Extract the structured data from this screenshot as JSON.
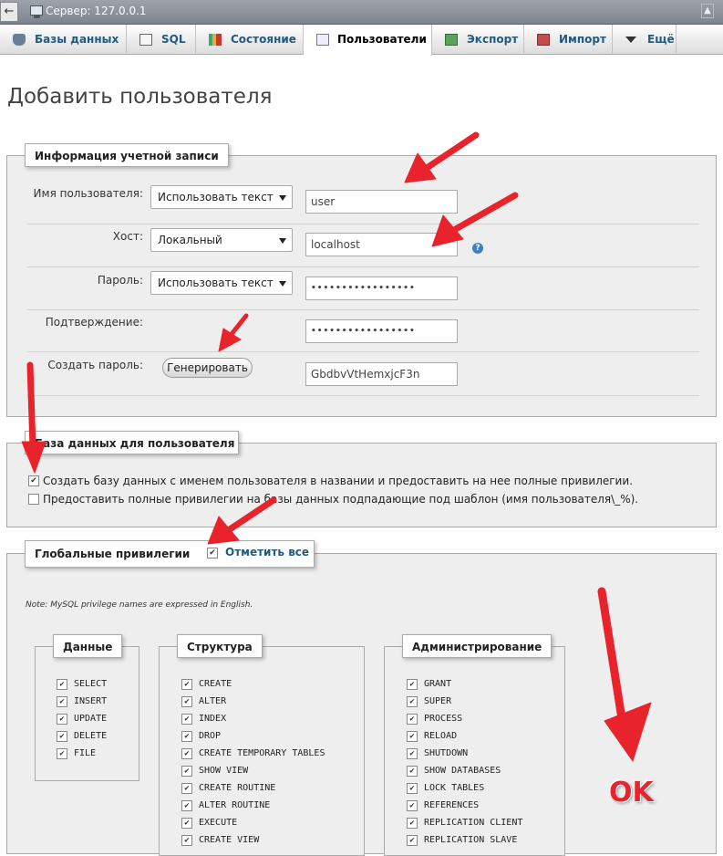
{
  "server_bar": {
    "title": "Сервер: 127.0.0.1"
  },
  "tabs": [
    {
      "label": "Базы данных",
      "icon": "database-icon"
    },
    {
      "label": "SQL",
      "icon": "sql-icon"
    },
    {
      "label": "Состояние",
      "icon": "status-icon"
    },
    {
      "label": "Пользователи",
      "icon": "users-icon",
      "active": true
    },
    {
      "label": "Экспорт",
      "icon": "export-icon"
    },
    {
      "label": "Импорт",
      "icon": "import-icon"
    },
    {
      "label": "Ещё",
      "icon": "chevron-down-icon"
    }
  ],
  "page_title": "Добавить пользователя",
  "account": {
    "legend": "Информация учетной записи",
    "username_label": "Имя пользователя:",
    "username_mode": "Использовать текст",
    "username_value": "user",
    "host_label": "Хост:",
    "host_mode": "Локальный",
    "host_value": "localhost",
    "password_label": "Пароль:",
    "password_mode": "Использовать текст",
    "password_value": "•••••••••••••••••",
    "confirm_label": "Подтверждение:",
    "confirm_value": "•••••••••••••••••",
    "generate_label": "Создать пароль:",
    "generate_button": "Генерировать",
    "generated_value": "GbdbvVtHemxjcF3n"
  },
  "database": {
    "legend": "База данных для пользователя",
    "option1": "Создать базу данных с именем пользователя в названии и предоставить на нее полные привилегии.",
    "option2": "Предоставить полные привилегии на базы данных подпадающие под шаблон (имя пользователя\\_%)."
  },
  "global": {
    "legend": "Глобальные привилегии",
    "check_all": "Отметить все",
    "note": "Note: MySQL privilege names are expressed in English.",
    "data_title": "Данные",
    "data_privs": [
      "SELECT",
      "INSERT",
      "UPDATE",
      "DELETE",
      "FILE"
    ],
    "structure_title": "Структура",
    "structure_privs": [
      "CREATE",
      "ALTER",
      "INDEX",
      "DROP",
      "CREATE TEMPORARY TABLES",
      "SHOW VIEW",
      "CREATE ROUTINE",
      "ALTER ROUTINE",
      "EXECUTE",
      "CREATE VIEW"
    ],
    "admin_title": "Администрирование",
    "admin_privs": [
      "GRANT",
      "SUPER",
      "PROCESS",
      "RELOAD",
      "SHUTDOWN",
      "SHOW DATABASES",
      "LOCK TABLES",
      "REFERENCES",
      "REPLICATION CLIENT",
      "REPLICATION SLAVE"
    ]
  },
  "annotation": {
    "ok_text": "OK",
    "arrow_color": "#e8232b"
  }
}
